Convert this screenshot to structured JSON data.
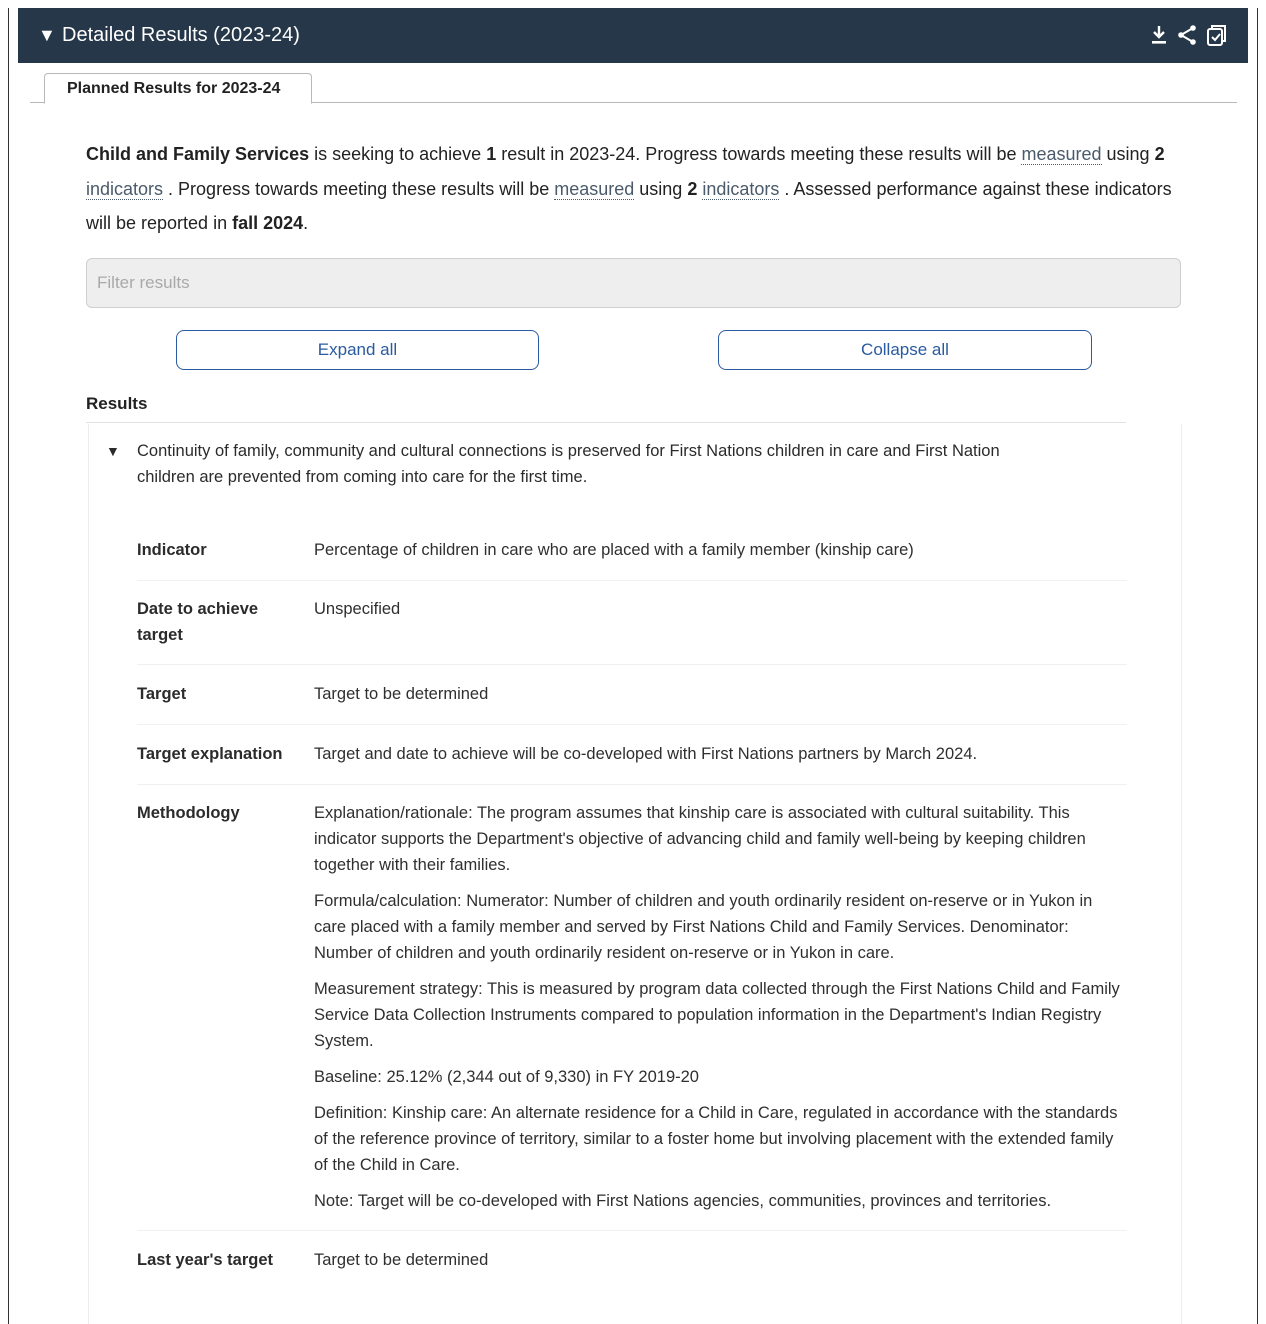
{
  "header": {
    "title": "Detailed Results (2023-24)",
    "caret": "▼",
    "icons": [
      "download-icon",
      "share-icon",
      "copy-icon"
    ]
  },
  "tab": {
    "label": "Planned Results for 2023-24"
  },
  "intro": {
    "org": "Child and Family Services",
    "s1": " is seeking to achieve ",
    "count_results": "1",
    "s2": " result in 2023-24. Progress towards meeting these results will be ",
    "measured": "measured",
    "s3": " using ",
    "count_ind": "2",
    "indicators": "indicators",
    "s4": " . Progress towards meeting these results will be ",
    "measured2": "measured",
    "s5": " using ",
    "count_ind2": "2",
    "indicators2": "indicators",
    "s6": " . Assessed performance against these indicators will be reported in ",
    "report_date": "fall 2024",
    "s7": "."
  },
  "filter": {
    "placeholder": "Filter results"
  },
  "buttons": {
    "expand": "Expand all",
    "collapse": "Collapse all"
  },
  "results": {
    "heading": "Results",
    "caret": "▼",
    "title": "Continuity of family, community and cultural connections is preserved for First Nations children in care and First Nation children are prevented from coming into care for the first time.",
    "rows": [
      {
        "label": "Indicator",
        "value": "Percentage of children in care who are placed with a family member (kinship care)"
      },
      {
        "label": "Date to achieve target",
        "value": "Unspecified"
      },
      {
        "label": "Target",
        "value": "Target to be determined"
      },
      {
        "label": "Target explanation",
        "value": "Target and date to achieve will be co-developed with First Nations partners by March 2024."
      },
      {
        "label": "Methodology"
      },
      {
        "label": "Last year's target",
        "value": "Target to be determined"
      }
    ],
    "methodology": [
      "Explanation/rationale: The program assumes that kinship care is associated with cultural suitability. This indicator supports the Department's objective of advancing child and family well-being by keeping children together with their families.",
      "Formula/calculation: Numerator: Number of children and youth ordinarily resident on-reserve or in Yukon in care placed with a family member and served by First Nations Child and Family Services. Denominator: Number of children and youth ordinarily resident on-reserve or in Yukon in care.",
      "Measurement strategy: This is measured by program data collected through the First Nations Child and Family Service Data Collection Instruments compared to population information in the Department's Indian Registry System.",
      "Baseline: 25.12% (2,344 out of 9,330) in FY 2019-20",
      "Definition: Kinship care: An alternate residence for a Child in Care, regulated in accordance with the standards of the reference province of territory, similar to a foster home but involving placement with the extended family of the Child in Care.",
      "Note: Target will be co-developed with First Nations agencies, communities, provinces and territories."
    ]
  }
}
